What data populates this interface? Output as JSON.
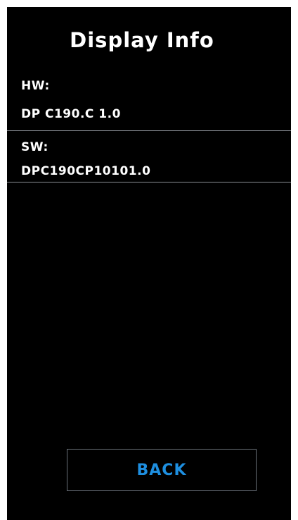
{
  "header": {
    "title": "Display Info"
  },
  "info": {
    "hw_label": "HW:",
    "hw_value": "DP C190.C 1.0",
    "sw_label": "SW:",
    "sw_value": "DPC190CP10101.0"
  },
  "footer": {
    "back_label": "BACK"
  },
  "colors": {
    "background": "#000000",
    "text": "#ffffff",
    "accent": "#1e8fe0",
    "divider": "#8a8f95"
  }
}
